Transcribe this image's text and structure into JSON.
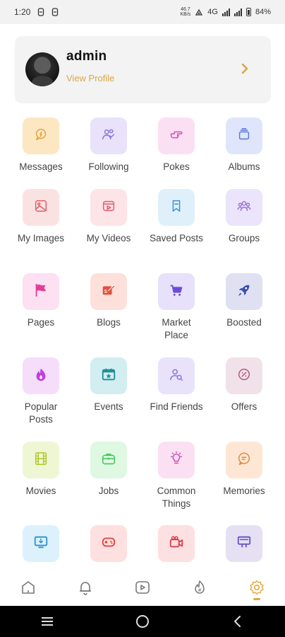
{
  "status_bar": {
    "time": "1:20",
    "speed_value": "46.7",
    "speed_unit": "KB/s",
    "network": "4G",
    "battery": "84%"
  },
  "profile": {
    "name": "admin",
    "link_label": "View Profile",
    "accent": "#d9a74a"
  },
  "menu": {
    "items": [
      {
        "label": "Messages",
        "icon": "chat-bubble-icon",
        "bg": "#fde7c2",
        "fg": "#e0a53c"
      },
      {
        "label": "Following",
        "icon": "users-check-icon",
        "bg": "#e8e2fb",
        "fg": "#8a72d8"
      },
      {
        "label": "Pokes",
        "icon": "hand-point-icon",
        "bg": "#fbe0f3",
        "fg": "#d34fb0"
      },
      {
        "label": "Albums",
        "icon": "album-stack-icon",
        "bg": "#dfe6fb",
        "fg": "#5b78d8"
      },
      {
        "label": "My Images",
        "icon": "image-icon",
        "bg": "#fbe2e2",
        "fg": "#e05b6a"
      },
      {
        "label": "My Videos",
        "icon": "video-play-icon",
        "bg": "#fde4e6",
        "fg": "#e25c6c"
      },
      {
        "label": "Saved Posts",
        "icon": "bookmark-icon",
        "bg": "#dff0fb",
        "fg": "#3b8fd1"
      },
      {
        "label": "Groups",
        "icon": "group-icon",
        "bg": "#ece4fb",
        "fg": "#9a72d8"
      },
      {
        "label": "Pages",
        "icon": "flag-icon",
        "bg": "#fde0f1",
        "fg": "#e33c9a"
      },
      {
        "label": "Blogs",
        "icon": "blog-edit-icon",
        "bg": "#fde0d9",
        "fg": "#e2503c"
      },
      {
        "label": "Market Place",
        "icon": "cart-icon",
        "bg": "#e7e1fb",
        "fg": "#6d4cd6"
      },
      {
        "label": "Boosted",
        "icon": "rocket-icon",
        "bg": "#dfe1f3",
        "fg": "#3c4fb0"
      },
      {
        "label": "Popular Posts",
        "icon": "fire-icon",
        "bg": "#f4def9",
        "fg": "#c13ee0"
      },
      {
        "label": "Events",
        "icon": "calendar-star-icon",
        "bg": "#d3eef0",
        "fg": "#1f8f99"
      },
      {
        "label": "Find Friends",
        "icon": "user-search-icon",
        "bg": "#e8e2fb",
        "fg": "#8a72d8"
      },
      {
        "label": "Offers",
        "icon": "discount-icon",
        "bg": "#f1e2e9",
        "fg": "#b05a80"
      },
      {
        "label": "Movies",
        "icon": "film-icon",
        "bg": "#eef6d3",
        "fg": "#b4c82c"
      },
      {
        "label": "Jobs",
        "icon": "briefcase-icon",
        "bg": "#dff8e2",
        "fg": "#3fc35a"
      },
      {
        "label": "Common Things",
        "icon": "lightbulb-icon",
        "bg": "#fbe0f3",
        "fg": "#d34fb0"
      },
      {
        "label": "Memories",
        "icon": "memory-chat-icon",
        "bg": "#fde7d4",
        "fg": "#e08a3c"
      },
      {
        "label": "",
        "icon": "monitor-download-icon",
        "bg": "#dcf1fb",
        "fg": "#2f94c9"
      },
      {
        "label": "",
        "icon": "gamepad-icon",
        "bg": "#fde0df",
        "fg": "#e0433c"
      },
      {
        "label": "",
        "icon": "video-camera-icon",
        "bg": "#fde0e1",
        "fg": "#d8414a"
      },
      {
        "label": "",
        "icon": "presentation-icon",
        "bg": "#e5e1f3",
        "fg": "#6a4fc4"
      }
    ]
  },
  "bottom_nav": [
    {
      "icon": "home-icon",
      "active": false
    },
    {
      "icon": "bell-icon",
      "active": false
    },
    {
      "icon": "play-icon",
      "active": false
    },
    {
      "icon": "trending-icon",
      "active": false
    },
    {
      "icon": "settings-gear-icon",
      "active": true
    }
  ],
  "system_nav": [
    {
      "icon": "recents-icon"
    },
    {
      "icon": "home-circle-icon"
    },
    {
      "icon": "back-icon"
    }
  ]
}
